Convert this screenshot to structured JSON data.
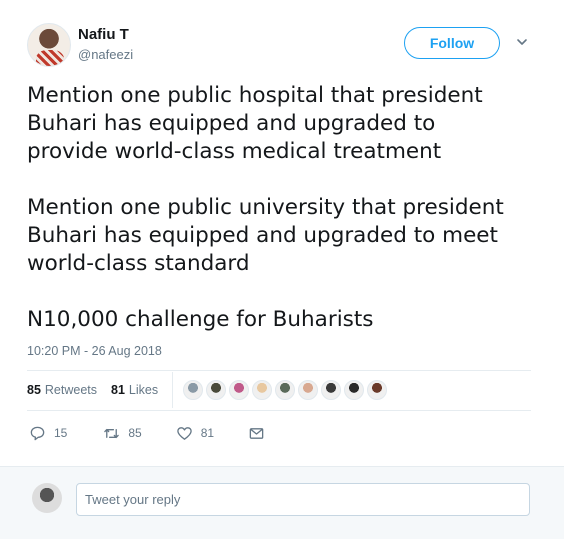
{
  "user": {
    "name": "Nafiu T",
    "handle": "@nafeezi"
  },
  "follow_label": "Follow",
  "tweet": {
    "paragraphs": [
      [
        "Mention one public hospital that president",
        "Buhari has equipped and upgraded to",
        "provide world-class medical treatment"
      ],
      [
        "Mention one public university that president",
        "Buhari has equipped and upgraded to meet",
        "world-class standard"
      ],
      [
        "N10,000 challenge for Buharists"
      ]
    ],
    "timestamp": "10:20 PM - 26 Aug 2018"
  },
  "stats": {
    "retweets_count": "85",
    "retweets_label": "Retweets",
    "likes_count": "81",
    "likes_label": "Likes"
  },
  "likers": [
    "#8a9aa6",
    "#4a4a3a",
    "#c05a8a",
    "#e8c8a0",
    "#5a6a5a",
    "#d8a890",
    "#3a3a3a",
    "#2a2a2a",
    "#6a3a2a"
  ],
  "actions": {
    "reply_count": "15",
    "retweet_count": "85",
    "like_count": "81"
  },
  "reply": {
    "placeholder": "Tweet your reply"
  },
  "colors": {
    "accent": "#1da1f2",
    "secondary_text": "#657786",
    "border": "#e6ecf0"
  },
  "icons": {
    "caret": "chevron-down-icon",
    "reply": "reply-icon",
    "retweet": "retweet-icon",
    "like": "heart-icon",
    "dm": "envelope-icon"
  }
}
